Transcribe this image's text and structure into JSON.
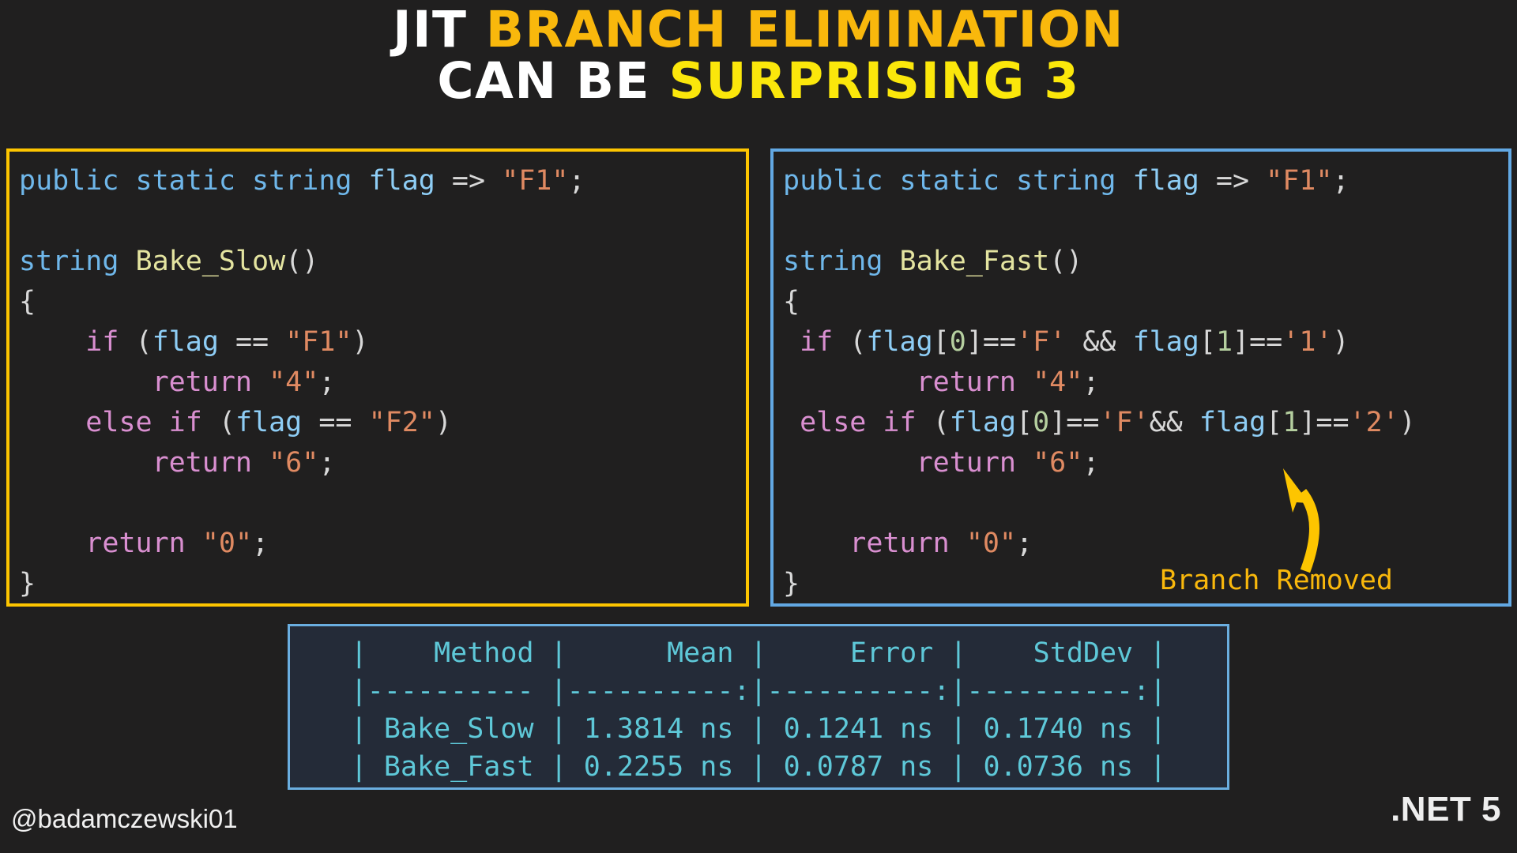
{
  "title": {
    "line1_part1": "JIT ",
    "line1_part2": "BRANCH ELIMINATION",
    "line2_part1": "CAN BE ",
    "line2_part2": "SURPRISING 3"
  },
  "colors": {
    "background": "#201f1f",
    "title_white": "#ffffff",
    "title_amber": "#f9b80c",
    "title_yellow": "#fbe70b",
    "left_panel_border": "#fdc500",
    "right_panel_border": "#62a8e3",
    "arrow": "#fdc500",
    "table_text": "#5ec8d8",
    "table_background": "#242b38",
    "table_border": "#6aaee0"
  },
  "left_code": {
    "lines": [
      [
        {
          "t": "public",
          "c": "k"
        },
        {
          "t": " ",
          "c": "pn"
        },
        {
          "t": "static",
          "c": "k"
        },
        {
          "t": " ",
          "c": "pn"
        },
        {
          "t": "string",
          "c": "k"
        },
        {
          "t": " ",
          "c": "pn"
        },
        {
          "t": "flag",
          "c": "id"
        },
        {
          "t": " => ",
          "c": "pn"
        },
        {
          "t": "\"F1\"",
          "c": "st"
        },
        {
          "t": ";",
          "c": "pn"
        }
      ],
      [],
      [
        {
          "t": "string",
          "c": "k"
        },
        {
          "t": " ",
          "c": "pn"
        },
        {
          "t": "Bake_Slow",
          "c": "fn"
        },
        {
          "t": "()",
          "c": "pn"
        }
      ],
      [
        {
          "t": "{",
          "c": "pn"
        }
      ],
      [
        {
          "t": "    ",
          "c": "pn"
        },
        {
          "t": "if",
          "c": "kf"
        },
        {
          "t": " (",
          "c": "pn"
        },
        {
          "t": "flag",
          "c": "id"
        },
        {
          "t": " == ",
          "c": "pn"
        },
        {
          "t": "\"F1\"",
          "c": "st"
        },
        {
          "t": ")",
          "c": "pn"
        }
      ],
      [
        {
          "t": "        ",
          "c": "pn"
        },
        {
          "t": "return",
          "c": "kf"
        },
        {
          "t": " ",
          "c": "pn"
        },
        {
          "t": "\"4\"",
          "c": "st"
        },
        {
          "t": ";",
          "c": "pn"
        }
      ],
      [
        {
          "t": "    ",
          "c": "pn"
        },
        {
          "t": "else if",
          "c": "kf"
        },
        {
          "t": " (",
          "c": "pn"
        },
        {
          "t": "flag",
          "c": "id"
        },
        {
          "t": " == ",
          "c": "pn"
        },
        {
          "t": "\"F2\"",
          "c": "st"
        },
        {
          "t": ")",
          "c": "pn"
        }
      ],
      [
        {
          "t": "        ",
          "c": "pn"
        },
        {
          "t": "return",
          "c": "kf"
        },
        {
          "t": " ",
          "c": "pn"
        },
        {
          "t": "\"6\"",
          "c": "st"
        },
        {
          "t": ";",
          "c": "pn"
        }
      ],
      [],
      [
        {
          "t": "    ",
          "c": "pn"
        },
        {
          "t": "return",
          "c": "kf"
        },
        {
          "t": " ",
          "c": "pn"
        },
        {
          "t": "\"0\"",
          "c": "st"
        },
        {
          "t": ";",
          "c": "pn"
        }
      ],
      [
        {
          "t": "}",
          "c": "pn"
        }
      ]
    ],
    "plain_text": "public static string flag => \"F1\";\n\nstring Bake_Slow()\n{\n    if (flag == \"F1\")\n        return \"4\";\n    else if (flag == \"F2\")\n        return \"6\";\n\n    return \"0\";\n}"
  },
  "right_code": {
    "lines": [
      [
        {
          "t": "public",
          "c": "k"
        },
        {
          "t": " ",
          "c": "pn"
        },
        {
          "t": "static",
          "c": "k"
        },
        {
          "t": " ",
          "c": "pn"
        },
        {
          "t": "string",
          "c": "k"
        },
        {
          "t": " ",
          "c": "pn"
        },
        {
          "t": "flag",
          "c": "id"
        },
        {
          "t": " => ",
          "c": "pn"
        },
        {
          "t": "\"F1\"",
          "c": "st"
        },
        {
          "t": ";",
          "c": "pn"
        }
      ],
      [],
      [
        {
          "t": "string",
          "c": "k"
        },
        {
          "t": " ",
          "c": "pn"
        },
        {
          "t": "Bake_Fast",
          "c": "fn"
        },
        {
          "t": "()",
          "c": "pn"
        }
      ],
      [
        {
          "t": "{",
          "c": "pn"
        }
      ],
      [
        {
          "t": " ",
          "c": "pn"
        },
        {
          "t": "if",
          "c": "kf"
        },
        {
          "t": " (",
          "c": "pn"
        },
        {
          "t": "flag",
          "c": "id"
        },
        {
          "t": "[",
          "c": "pn"
        },
        {
          "t": "0",
          "c": "nu"
        },
        {
          "t": "]==",
          "c": "pn"
        },
        {
          "t": "'F'",
          "c": "st"
        },
        {
          "t": " && ",
          "c": "pn"
        },
        {
          "t": "flag",
          "c": "id"
        },
        {
          "t": "[",
          "c": "pn"
        },
        {
          "t": "1",
          "c": "nu"
        },
        {
          "t": "]==",
          "c": "pn"
        },
        {
          "t": "'1'",
          "c": "st"
        },
        {
          "t": ")",
          "c": "pn"
        }
      ],
      [
        {
          "t": "        ",
          "c": "pn"
        },
        {
          "t": "return",
          "c": "kf"
        },
        {
          "t": " ",
          "c": "pn"
        },
        {
          "t": "\"4\"",
          "c": "st"
        },
        {
          "t": ";",
          "c": "pn"
        }
      ],
      [
        {
          "t": " ",
          "c": "pn"
        },
        {
          "t": "else if",
          "c": "kf"
        },
        {
          "t": " (",
          "c": "pn"
        },
        {
          "t": "flag",
          "c": "id"
        },
        {
          "t": "[",
          "c": "pn"
        },
        {
          "t": "0",
          "c": "nu"
        },
        {
          "t": "]==",
          "c": "pn"
        },
        {
          "t": "'F'",
          "c": "st"
        },
        {
          "t": "&& ",
          "c": "pn"
        },
        {
          "t": "flag",
          "c": "id"
        },
        {
          "t": "[",
          "c": "pn"
        },
        {
          "t": "1",
          "c": "nu"
        },
        {
          "t": "]==",
          "c": "pn"
        },
        {
          "t": "'2'",
          "c": "st"
        },
        {
          "t": ")",
          "c": "pn"
        }
      ],
      [
        {
          "t": "        ",
          "c": "pn"
        },
        {
          "t": "return",
          "c": "kf"
        },
        {
          "t": " ",
          "c": "pn"
        },
        {
          "t": "\"6\"",
          "c": "st"
        },
        {
          "t": ";",
          "c": "pn"
        }
      ],
      [],
      [
        {
          "t": "    ",
          "c": "pn"
        },
        {
          "t": "return",
          "c": "kf"
        },
        {
          "t": " ",
          "c": "pn"
        },
        {
          "t": "\"0\"",
          "c": "st"
        },
        {
          "t": ";",
          "c": "pn"
        }
      ],
      [
        {
          "t": "}",
          "c": "pn"
        }
      ]
    ],
    "plain_text": "public static string flag => \"F1\";\n\nstring Bake_Fast()\n{\n if (flag[0]=='F' && flag[1]=='1')\n        return \"4\";\n else if (flag[0]=='F'&& flag[1]=='2')\n        return \"6\";\n\n    return \"0\";\n}"
  },
  "annotation": {
    "label": "Branch Removed"
  },
  "benchmark": {
    "rows": [
      "|    Method |      Mean |     Error |    StdDev |",
      "|---------- |----------:|----------:|----------:|",
      "| Bake_Slow | 1.3814 ns | 0.1241 ns | 0.1740 ns |",
      "| Bake_Fast | 0.2255 ns | 0.0787 ns | 0.0736 ns |"
    ],
    "columns": [
      "Method",
      "Mean",
      "Error",
      "StdDev"
    ],
    "data": [
      {
        "Method": "Bake_Slow",
        "Mean": "1.3814 ns",
        "Error": "0.1241 ns",
        "StdDev": "0.1740 ns"
      },
      {
        "Method": "Bake_Fast",
        "Mean": "0.2255 ns",
        "Error": "0.0787 ns",
        "StdDev": "0.0736 ns"
      }
    ]
  },
  "footer": {
    "handle": "@badamczewski01",
    "badge": ".NET 5"
  }
}
